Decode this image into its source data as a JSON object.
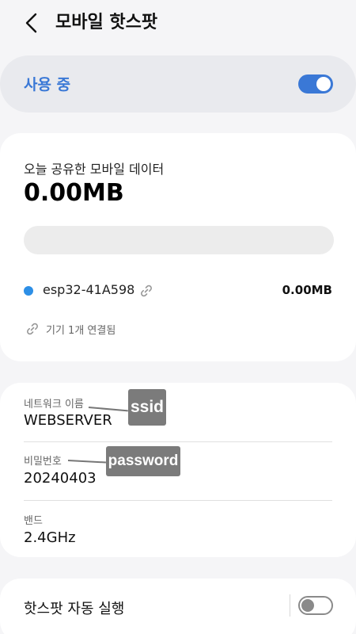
{
  "header": {
    "title": "모바일 핫스팟"
  },
  "usage": {
    "label": "사용 중",
    "enabled": true
  },
  "data_usage": {
    "label": "오늘 공유한 모바일 데이터",
    "amount": "0.00MB",
    "device": {
      "name": "esp32-41A598",
      "usage": "0.00MB"
    },
    "connected": "기기 1개 연결됨"
  },
  "network": {
    "name_label": "네트워크 이름",
    "name_value": "WEBSERVER",
    "name_callout": "ssid",
    "password_label": "비밀번호",
    "password_value": "20240403",
    "password_callout": "password",
    "band_label": "밴드",
    "band_value": "2.4GHz"
  },
  "auto": {
    "label": "핫스팟 자동 실행",
    "enabled": false
  },
  "colors": {
    "accent": "#3a78d6",
    "device_dot": "#2d8fe6",
    "callout": "#7b7b7b"
  },
  "icons": {
    "back": "chevron-left-icon",
    "link": "link-icon"
  }
}
